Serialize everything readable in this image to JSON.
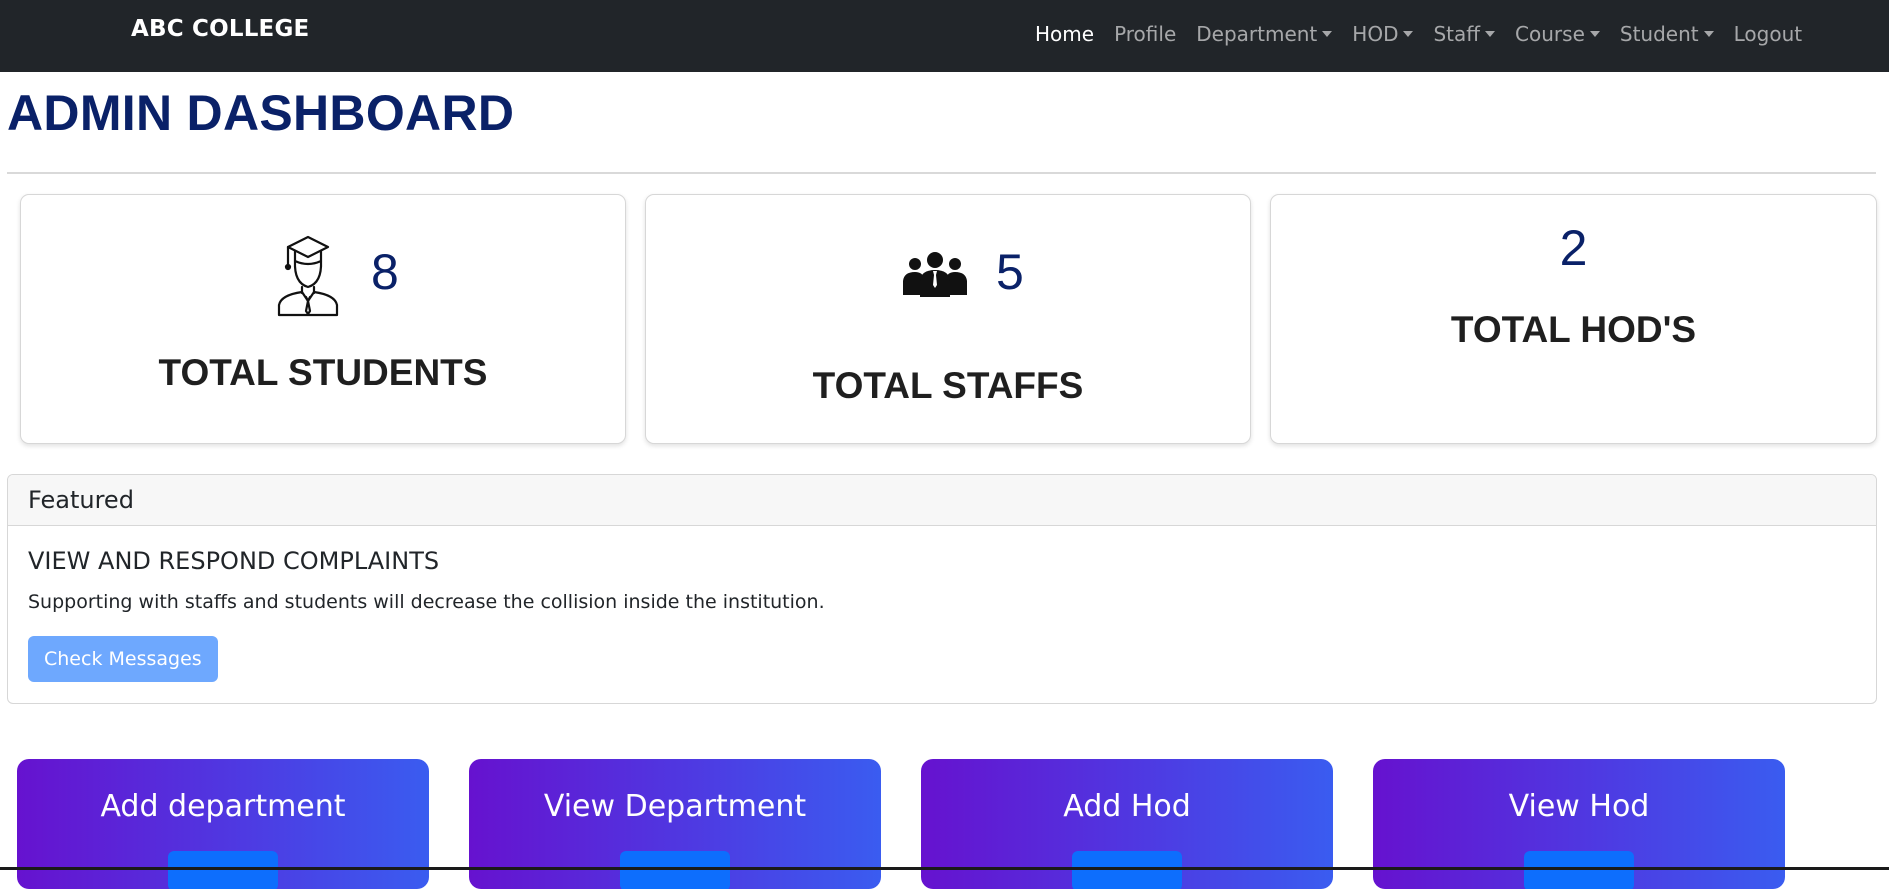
{
  "navbar": {
    "brand": "ABC COLLEGE",
    "items": [
      {
        "label": "Home",
        "active": true,
        "dropdown": false
      },
      {
        "label": "Profile",
        "active": false,
        "dropdown": false
      },
      {
        "label": "Department",
        "active": false,
        "dropdown": true
      },
      {
        "label": "HOD",
        "active": false,
        "dropdown": true
      },
      {
        "label": "Staff",
        "active": false,
        "dropdown": true
      },
      {
        "label": "Course",
        "active": false,
        "dropdown": true
      },
      {
        "label": "Student",
        "active": false,
        "dropdown": true
      },
      {
        "label": "Logout",
        "active": false,
        "dropdown": false
      }
    ]
  },
  "page": {
    "title": "ADMIN DASHBOARD"
  },
  "stats": [
    {
      "count": "8",
      "label": "TOTAL STUDENTS",
      "icon": "graduate-icon"
    },
    {
      "count": "5",
      "label": "TOTAL STAFFS",
      "icon": "group-icon"
    },
    {
      "count": "2",
      "label": "TOTAL HOD'S",
      "icon": ""
    }
  ],
  "featured": {
    "header": "Featured",
    "title": "VIEW AND RESPOND COMPLAINTS",
    "text": "Supporting with staffs and students will decrease the collision inside the institution.",
    "button": "Check Messages"
  },
  "actions": [
    {
      "title": "Add department"
    },
    {
      "title": "View Department"
    },
    {
      "title": "Add Hod"
    },
    {
      "title": "View Hod"
    }
  ],
  "colors": {
    "navbar": "#212529",
    "title": "#0a2168",
    "button_light": "#6ea8fe",
    "card_gradient_start": "#6612cf",
    "card_gradient_end": "#3a5cf0"
  }
}
